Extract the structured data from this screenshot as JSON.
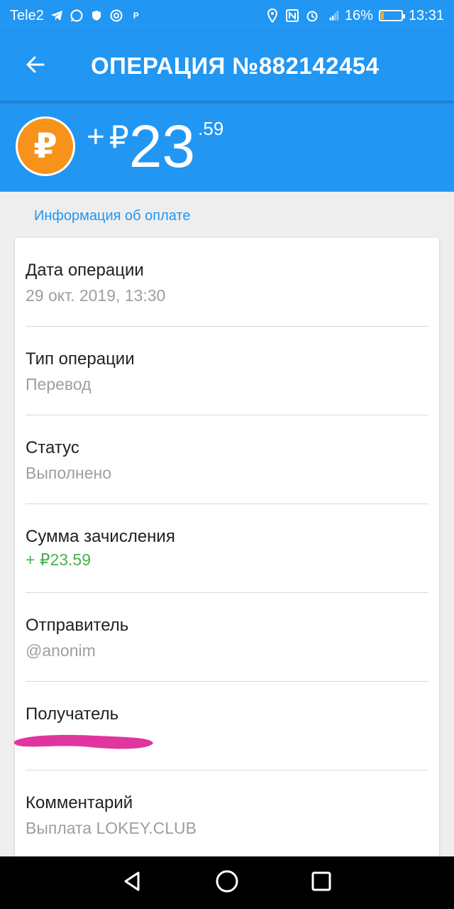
{
  "status_bar": {
    "carrier": "Tele2",
    "battery": "16%",
    "battery_level": 0.16,
    "time": "13:31",
    "left_icons": [
      "telegram-icon",
      "whatsapp-icon",
      "shield-icon",
      "at-icon",
      "p-notification-icon"
    ],
    "right_icons": [
      "location-icon",
      "nfc-icon",
      "alarm-icon",
      "signal-icon",
      "battery-icon"
    ]
  },
  "app_bar": {
    "title": "ОПЕРАЦИЯ №882142454",
    "back_icon": "arrow-left-icon"
  },
  "amount": {
    "sign": "+",
    "currency": "₽",
    "main": "23",
    "cents": ".59",
    "coin_symbol": "₽",
    "coin_color": "#f7931a"
  },
  "section": {
    "title": "Информация об оплате"
  },
  "rows": [
    {
      "label": "Дата операции",
      "value": "29 окт. 2019, 13:30"
    },
    {
      "label": "Тип операции",
      "value": "Перевод"
    },
    {
      "label": "Статус",
      "value": "Выполнено"
    },
    {
      "label": "Сумма зачисления",
      "value": "+ ₽23.59"
    },
    {
      "label": "Отправитель",
      "value": "@anonim"
    },
    {
      "label": "Получатель",
      "value": ""
    },
    {
      "label": "Комментарий",
      "value": "Выплата LOKEY.CLUB"
    }
  ],
  "colors": {
    "primary": "#2196f3",
    "positive": "#4caf50",
    "redaction": "#e0359f"
  },
  "nav_bar": {
    "icons": [
      "back-triangle-icon",
      "home-circle-icon",
      "recents-square-icon"
    ]
  }
}
